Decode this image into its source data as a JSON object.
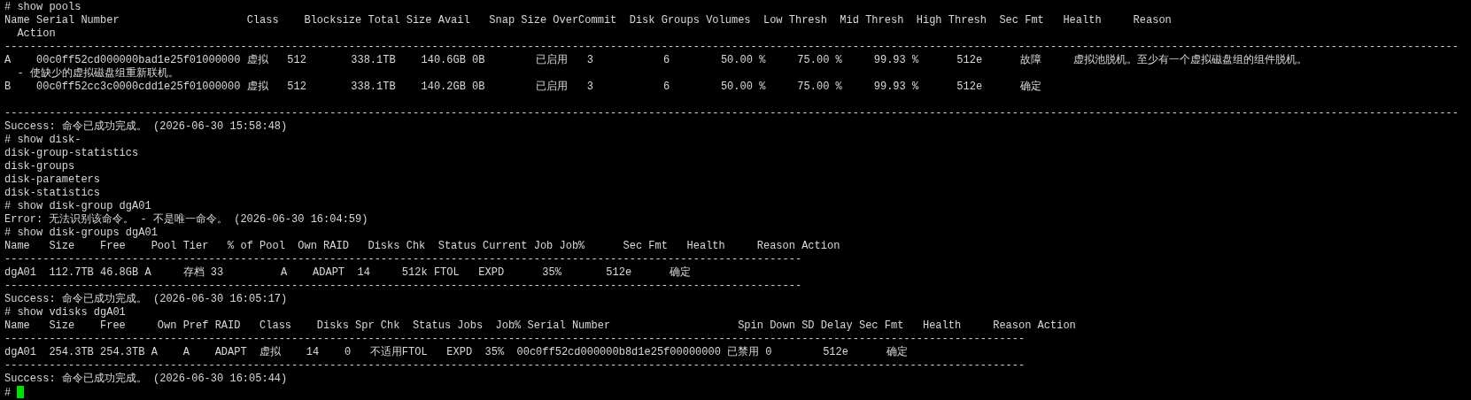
{
  "lines": [
    {
      "kind": "command",
      "text": "# show pools"
    },
    {
      "kind": "output",
      "text": "Name Serial Number                    Class    Blocksize Total Size Avail   Snap Size OverCommit  Disk Groups Volumes  Low Thresh  Mid Thresh  High Thresh  Sec Fmt   Health     Reason"
    },
    {
      "kind": "output",
      "text": "  Action"
    },
    {
      "kind": "rule",
      "text": "------------------------------------------------------------------------------------------------------------------------------------------------------------------------------------------------------------------------------------"
    },
    {
      "kind": "output",
      "text": "A    00c0ff52cd000000bad1e25f01000000 虚拟   512       338.1TB    140.6GB 0B        已启用   3           6        50.00 %     75.00 %     99.93 %      512e      故障     虚拟池脱机。至少有一个虚拟磁盘组的组件脱机。"
    },
    {
      "kind": "output",
      "text": "  - 使缺少的虚拟磁盘组重新联机。"
    },
    {
      "kind": "output",
      "text": "B    00c0ff52cc3c0000cdd1e25f01000000 虚拟   512       338.1TB    140.2GB 0B        已启用   3           6        50.00 %     75.00 %     99.93 %      512e      确定"
    },
    {
      "kind": "spaced-rule",
      "text": "------------------------------------------------------------------------------------------------------------------------------------------------------------------------------------------------------------------------------------"
    },
    {
      "kind": "output",
      "text": "Success: 命令已成功完成。 (2026-06-30 15:58:48)"
    },
    {
      "kind": "command",
      "text": "# show disk-"
    },
    {
      "kind": "output",
      "text": "disk-group-statistics"
    },
    {
      "kind": "output",
      "text": "disk-groups"
    },
    {
      "kind": "output",
      "text": "disk-parameters"
    },
    {
      "kind": "output",
      "text": "disk-statistics"
    },
    {
      "kind": "command",
      "text": "# show disk-group dgA01"
    },
    {
      "kind": "output",
      "text": "Error: 无法识别该命令。 - 不是唯一命令。 (2026-06-30 16:04:59)"
    },
    {
      "kind": "command",
      "text": "# show disk-groups dgA01"
    },
    {
      "kind": "output",
      "text": "Name   Size    Free    Pool Tier   % of Pool  Own RAID   Disks Chk  Status Current Job Job%      Sec Fmt   Health     Reason Action"
    },
    {
      "kind": "rule",
      "text": "-----------------------------------------------------------------------------------------------------------------------------"
    },
    {
      "kind": "output",
      "text": "dgA01  112.7TB 46.8GB A     存档 33         A    ADAPT  14     512k FTOL   EXPD      35%       512e      确定"
    },
    {
      "kind": "rule",
      "text": "-----------------------------------------------------------------------------------------------------------------------------"
    },
    {
      "kind": "output",
      "text": "Success: 命令已成功完成。 (2026-06-30 16:05:17)"
    },
    {
      "kind": "command",
      "text": "# show vdisks dgA01"
    },
    {
      "kind": "output",
      "text": "Name   Size    Free     Own Pref RAID   Class    Disks Spr Chk  Status Jobs  Job% Serial Number                    Spin Down SD Delay Sec Fmt   Health     Reason Action"
    },
    {
      "kind": "rule",
      "text": "----------------------------------------------------------------------------------------------------------------------------------------------------------------"
    },
    {
      "kind": "output",
      "text": "dgA01  254.3TB 254.3TB A    A    ADAPT  虚拟    14    0   不适用FTOL   EXPD  35%  00c0ff52cd000000b8d1e25f00000000 已禁用 0        512e      确定"
    },
    {
      "kind": "rule",
      "text": "----------------------------------------------------------------------------------------------------------------------------------------------------------------"
    },
    {
      "kind": "output",
      "text": "Success: 命令已成功完成。 (2026-06-30 16:05:44)"
    }
  ],
  "prompt": {
    "text": "#",
    "cursor_visible": true
  }
}
